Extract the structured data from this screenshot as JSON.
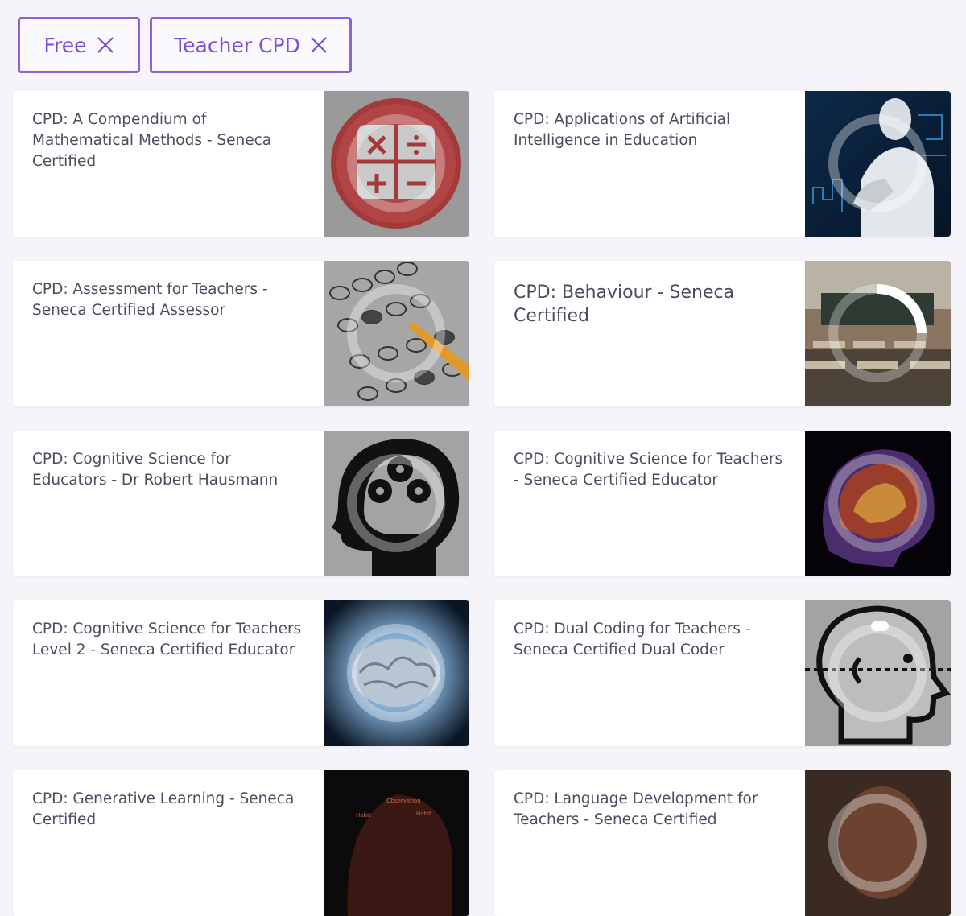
{
  "filters": [
    {
      "label": "Free",
      "remove_icon": "close-icon"
    },
    {
      "label": "Teacher CPD",
      "remove_icon": "close-icon"
    }
  ],
  "courses": [
    {
      "title": "CPD: A Compendium of Mathematical Methods - Seneca Certified",
      "image": "math-operators-icon"
    },
    {
      "title": "CPD: Applications of Artificial Intelligence in Education",
      "image": "ai-robot-image"
    },
    {
      "title": "CPD: Assessment for Teachers - Seneca Certified Assessor",
      "image": "answer-sheet-image"
    },
    {
      "title": "CPD: Behaviour - Seneca Certified",
      "image": "classroom-image"
    },
    {
      "title": "CPD: Cognitive Science for Educators - Dr Robert Hausmann",
      "image": "head-gears-icon"
    },
    {
      "title": "CPD: Cognitive Science for Teachers - Seneca Certified Educator",
      "image": "brain-scan-image"
    },
    {
      "title": "CPD: Cognitive Science for Teachers Level 2 - Seneca Certified Educator",
      "image": "glowing-brain-image"
    },
    {
      "title": "CPD: Dual Coding for Teachers - Seneca Certified Dual Coder",
      "image": "head-profile-icon"
    },
    {
      "title": "CPD: Generative Learning - Seneca Certified",
      "image": "word-cloud-head-image"
    },
    {
      "title": "CPD: Language Development for Teachers - Seneca Certified",
      "image": "child-photo-image"
    }
  ],
  "colors": {
    "accent": "#8b62d8",
    "title_text": "#4f4b5e",
    "background": "#f5f4f9"
  }
}
